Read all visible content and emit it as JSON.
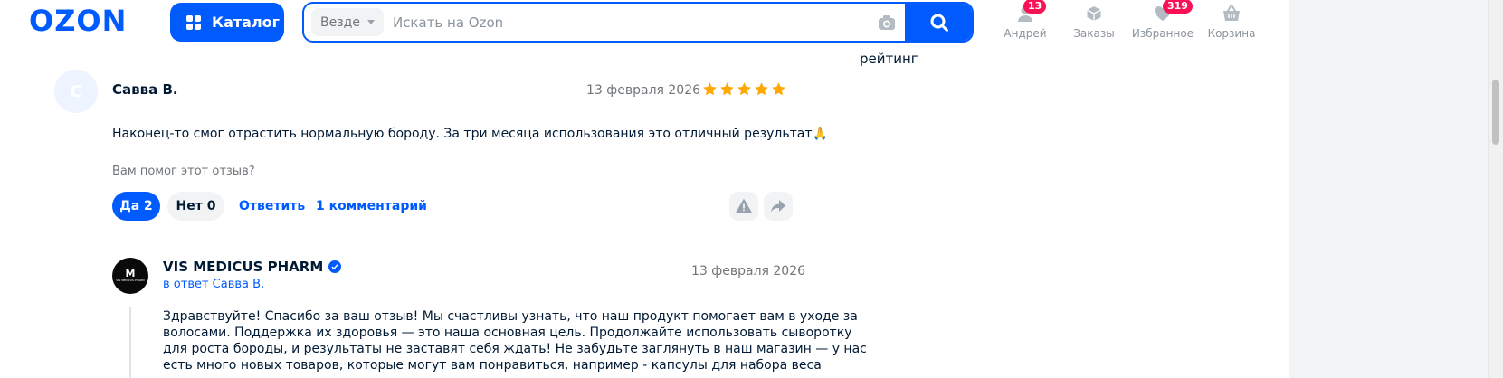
{
  "header": {
    "logo": "OZON",
    "catalog_label": "Каталог",
    "search": {
      "scope": "Везде",
      "placeholder": "Искать на Ozon"
    },
    "nav": [
      {
        "label": "Андрей",
        "badge": "13",
        "icon": "user-icon"
      },
      {
        "label": "Заказы",
        "badge": "",
        "icon": "box-icon"
      },
      {
        "label": "Избранное",
        "badge": "319",
        "icon": "heart-icon"
      },
      {
        "label": "Корзина",
        "badge": "",
        "icon": "basket-icon"
      }
    ]
  },
  "side_fragment": "рейтинг",
  "review": {
    "avatar_letter": "С",
    "author": "Савва В.",
    "date": "13 февраля 2026",
    "rating": 5,
    "text": "Наконец-то смог отрастить нормальную бороду. За три месяца использования это отличный результат🙏",
    "helpful_question": "Вам помог этот отзыв?",
    "yes_label": "Да 2",
    "no_label": "Нет 0",
    "reply_label": "Ответить",
    "comments_label": "1 комментарий"
  },
  "seller_reply": {
    "logo_mark": "M",
    "logo_text": "VIS MEDICUS PHARM",
    "name": "VIS MEDICUS PHARM",
    "in_reply_to": "в ответ Савва В.",
    "date": "13 февраля 2026",
    "lines": [
      "Здравствуйте! Спасибо за ваш отзыв! Мы счастливы узнать, что наш продукт помогает вам в уходе за",
      "волосами. Поддержка их здоровья — это наша основная цель. Продолжайте использовать сыворотку",
      "для роста бороды, и результаты не заставят себя ждать! Не забудьте заглянуть в наш магазин — у нас",
      "есть много новых товаров, которые могут вам понравиться, например - капсулы для набора веса"
    ]
  },
  "colors": {
    "brand": "#005bff",
    "star": "#ffa800",
    "badge": "#f91155"
  }
}
